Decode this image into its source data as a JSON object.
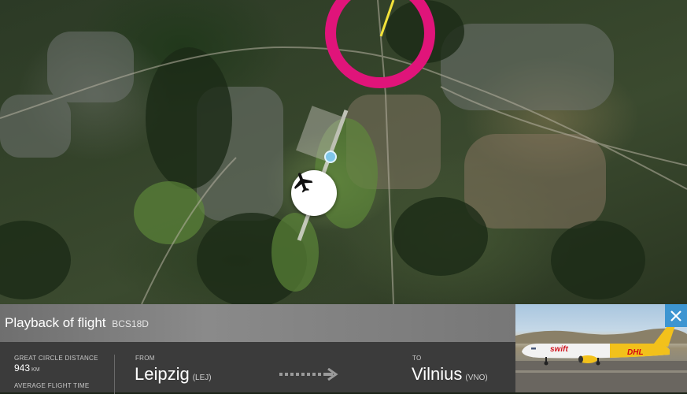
{
  "panel": {
    "title": "Playback of flight",
    "callsign": "BCS18D",
    "great_circle_label": "GREAT CIRCLE DISTANCE",
    "distance_value": "943",
    "distance_unit": "KM",
    "avg_time_label": "AVERAGE FLIGHT TIME",
    "from_label": "FROM",
    "from_city": "Leipzig",
    "from_code": "(LEJ)",
    "to_label": "TO",
    "to_city": "Vilnius",
    "to_code": "(VNO)"
  },
  "photo": {
    "livery_text": "swift",
    "tail_text": "DHL"
  },
  "colors": {
    "highlight_ring": "#e0147a",
    "flight_path": "#f2e23a",
    "close_button": "#3d95d1",
    "title_bar": "#7d7d7d",
    "info_bar": "#3b3b3b"
  },
  "icons": [
    "airplane-icon",
    "close-icon",
    "arrow-right-icon",
    "airport-pin-icon"
  ]
}
